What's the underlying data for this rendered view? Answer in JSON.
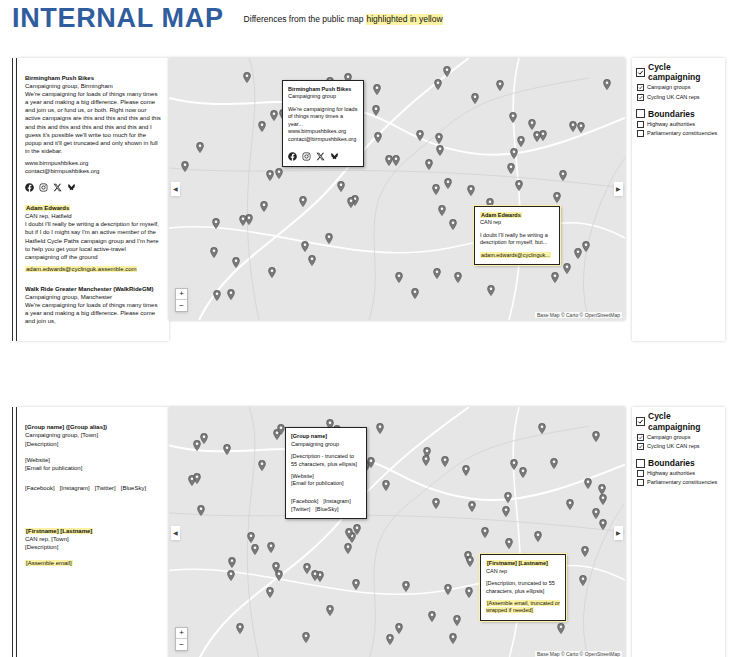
{
  "header": {
    "title": "INTERNAL MAP",
    "subtitle": "Differences from the public map",
    "subtitle_highlight": "highlighted in yellow"
  },
  "panels": [
    {
      "sidebar": {
        "entries": [
          {
            "kind": "group",
            "blocks": [
              [
                {
                  "text": "Birmingham Push Bikes",
                  "style": "title",
                  "highlighted": false
                },
                {
                  "text": "Campaigning group, Birmingham",
                  "style": "meta",
                  "highlighted": false
                },
                {
                  "text": "We're campaigning for loads of things many times a year and making a big difference. Please come and join us, or fund us, or both. Right now our active campaigns are this and this and this and this and this and this and this and this and this and I guess it's possible we'll write too much for the popup and it'll get truncated and only shown in full in the sidebar.",
                  "style": "body",
                  "highlighted": false
                }
              ],
              [
                {
                  "text": "www.birmpushbikes.org",
                  "style": "link",
                  "highlighted": false
                },
                {
                  "text": "contact@birmpushbikes.org",
                  "style": "link",
                  "highlighted": false
                }
              ]
            ],
            "socials": {
              "kind": "icons",
              "labels": []
            }
          },
          {
            "kind": "rep",
            "blocks": [
              [
                {
                  "text": "Adam Edwards",
                  "style": "title",
                  "highlighted": true
                },
                {
                  "text": "CAN rep, Hatfield",
                  "style": "meta",
                  "highlighted": false
                },
                {
                  "text": "I doubt I'll really be writing a description for myself, but if I do I might say I'm an active member of the Hatfield Cycle Paths campaign group and I'm here to help you get your local active-travel campaigning off the ground",
                  "style": "body",
                  "highlighted": false
                }
              ],
              [
                {
                  "text": "adam.edwards@cyclinguk.assemble.com",
                  "style": "link",
                  "highlighted": true
                }
              ]
            ],
            "socials": {
              "kind": "none",
              "labels": []
            }
          },
          {
            "kind": "group",
            "blocks": [
              [
                {
                  "text": "Walk Ride Greater Manchester (WalkRideGM)",
                  "style": "title",
                  "highlighted": false
                },
                {
                  "text": "Campaigning group, Manchester",
                  "style": "meta",
                  "highlighted": false
                },
                {
                  "text": "We're campaigning for loads of things many times a year and making a big difference. Please come and join us,",
                  "style": "body",
                  "highlighted": false
                }
              ]
            ],
            "socials": {
              "kind": "none",
              "labels": []
            }
          }
        ]
      },
      "popups": [
        {
          "highlighted": false,
          "blocks": [
            [
              {
                "text": "Birmingham Push Bikes",
                "style": "title",
                "highlighted": false
              },
              {
                "text": "Campaigning group",
                "style": "meta",
                "highlighted": false
              }
            ],
            [
              {
                "text": "We're campaigning for loads of things many times a year...",
                "style": "body",
                "highlighted": false
              },
              {
                "text": "www.birmpushbikes.org",
                "style": "link",
                "highlighted": false
              },
              {
                "text": "contact@birmpushbikes.org",
                "style": "link",
                "highlighted": false
              }
            ]
          ],
          "socials": {
            "kind": "icons",
            "labels": []
          }
        },
        {
          "highlighted": true,
          "blocks": [
            [
              {
                "text": "Adam Edwards",
                "style": "title",
                "highlighted": true
              },
              {
                "text": "CAN rep",
                "style": "meta",
                "highlighted": false
              }
            ],
            [
              {
                "text": "I doubt I'll really be writing a description for myself, but...",
                "style": "body",
                "highlighted": false
              }
            ],
            [
              {
                "text": "adam.edwards@cyclinguk...",
                "style": "link",
                "highlighted": true
              }
            ]
          ],
          "socials": {
            "kind": "none",
            "labels": []
          }
        }
      ],
      "map": {
        "collapse_left": "◀",
        "collapse_right": "▶",
        "zoom_in": "+",
        "zoom_out": "−",
        "attribution": "Base Map © Carto © OpenStreetMap"
      },
      "layers": [
        {
          "label": "Cycle campaigning",
          "checked": true,
          "items": [
            {
              "label": "Campaign groups",
              "checked": true
            },
            {
              "label": "Cycling UK CAN reps",
              "checked": true
            }
          ]
        },
        {
          "label": "Boundaries",
          "checked": false,
          "items": [
            {
              "label": "Highway authorities",
              "checked": false
            },
            {
              "label": "Parliamentary constituencies",
              "checked": false
            }
          ]
        }
      ]
    },
    {
      "sidebar": {
        "entries": [
          {
            "kind": "group",
            "blocks": [
              [
                {
                  "text": "[Group name] ([Group alias])",
                  "style": "title",
                  "highlighted": false
                },
                {
                  "text": "Campaigning group, [Town]",
                  "style": "meta",
                  "highlighted": false
                },
                {
                  "text": "[Description]",
                  "style": "body",
                  "highlighted": false
                }
              ],
              [
                {
                  "text": "[Website]",
                  "style": "link",
                  "highlighted": false
                },
                {
                  "text": "[Email for publication]",
                  "style": "link",
                  "highlighted": false
                }
              ]
            ],
            "socials": {
              "kind": "text",
              "labels": [
                "[Facebook]",
                "[Instagram]",
                "[Twitter]",
                "[BlueSky]"
              ]
            }
          },
          {
            "kind": "rep",
            "blocks": [
              [
                {
                  "text": "[Firstname] [Lastname]",
                  "style": "title",
                  "highlighted": true
                },
                {
                  "text": "CAN rep, [Town]",
                  "style": "meta",
                  "highlighted": false
                },
                {
                  "text": "[Description]",
                  "style": "body",
                  "highlighted": false
                }
              ],
              [
                {
                  "text": "[Assemble email]",
                  "style": "link",
                  "highlighted": true
                }
              ]
            ],
            "socials": {
              "kind": "none",
              "labels": []
            }
          }
        ]
      },
      "popups": [
        {
          "highlighted": false,
          "blocks": [
            [
              {
                "text": "[Group name]",
                "style": "title",
                "highlighted": false
              },
              {
                "text": "Campaigning group",
                "style": "meta",
                "highlighted": false
              }
            ],
            [
              {
                "text": "[Description - truncated to 55 characters, plus ellipsis]",
                "style": "body",
                "highlighted": false
              }
            ],
            [
              {
                "text": "[Website]",
                "style": "link",
                "highlighted": false
              },
              {
                "text": "[Email for publication]",
                "style": "link",
                "highlighted": false
              }
            ]
          ],
          "socials": {
            "kind": "text",
            "labels": [
              "[Facebook]",
              "[Instagram]",
              "[Twitter]",
              "[BlueSky]"
            ]
          }
        },
        {
          "highlighted": true,
          "blocks": [
            [
              {
                "text": "[Firstname] [Lastname]",
                "style": "title",
                "highlighted": true
              },
              {
                "text": "CAN rep",
                "style": "meta",
                "highlighted": false
              }
            ],
            [
              {
                "text": "[Description, truncated to 55 characters, plus ellipsis]",
                "style": "body",
                "highlighted": false
              }
            ],
            [
              {
                "text": "[Assemble email, truncated or wrapped if needed]",
                "style": "link",
                "highlighted": true
              }
            ]
          ],
          "socials": {
            "kind": "none",
            "labels": []
          }
        }
      ],
      "map": {
        "collapse_left": "◀",
        "collapse_right": "▶",
        "zoom_in": "+",
        "zoom_out": "−",
        "attribution": "Base Map © Carto © OpenStreetMap"
      },
      "layers": [
        {
          "label": "Cycle campaigning",
          "checked": true,
          "items": [
            {
              "label": "Campaign groups",
              "checked": true
            },
            {
              "label": "Cycling UK CAN reps",
              "checked": true
            }
          ]
        },
        {
          "label": "Boundaries",
          "checked": false,
          "items": [
            {
              "label": "Highway authorities",
              "checked": false
            },
            {
              "label": "Parliamentary constituencies",
              "checked": false
            }
          ]
        }
      ]
    }
  ]
}
